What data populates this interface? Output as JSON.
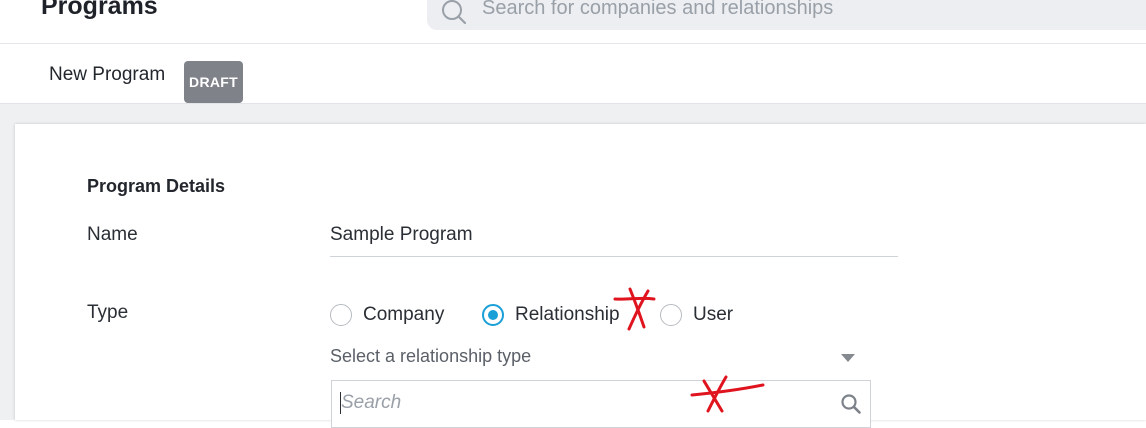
{
  "header": {
    "title": "Programs",
    "search_placeholder": "Search for companies and relationships",
    "search_icon": "search-icon"
  },
  "program": {
    "name": "New Program",
    "status": "DRAFT"
  },
  "form": {
    "section_title": "Program Details",
    "name_label": "Name",
    "name_value": "Sample Program",
    "type_label": "Type",
    "type_options": [
      {
        "label": "Company",
        "selected": false
      },
      {
        "label": "Relationship",
        "selected": true
      },
      {
        "label": "User",
        "selected": false
      }
    ],
    "relationship_select_placeholder": "Select a relationship type",
    "dropdown_search_placeholder": "Search",
    "dropdown_search_icon": "search-icon"
  },
  "colors": {
    "accent": "#1a9fd6",
    "badge": "#7f8389",
    "annotation": "#e0141e"
  }
}
